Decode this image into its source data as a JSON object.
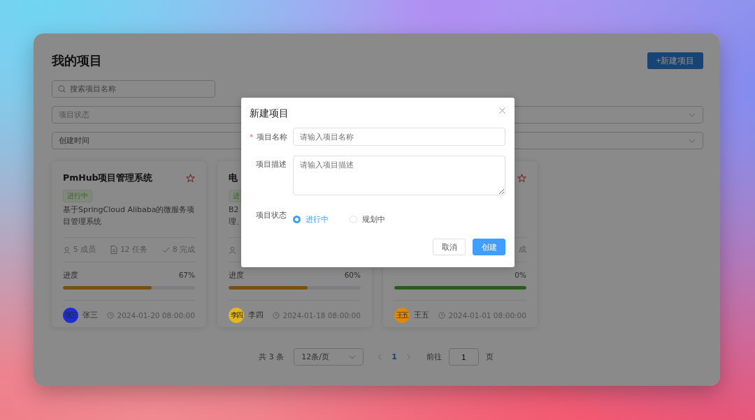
{
  "page": {
    "title": "我的项目",
    "new_button": "+新建项目",
    "search": {
      "placeholder": "搜索项目名称"
    },
    "filters": [
      {
        "placeholder": "项目状态"
      },
      {
        "value": "创建时间"
      }
    ]
  },
  "cards": [
    {
      "title": "PmHub项目管理系统",
      "tag": "进行中",
      "star": true,
      "description": [
        "基于SpringCloud Alibaba的微服务项",
        "目管理系统"
      ],
      "stats": [
        {
          "kind": "members",
          "text": "5 成员",
          "show_icon": true
        },
        {
          "kind": "tasks",
          "text": "12 任务",
          "show_icon": true
        },
        {
          "kind": "done",
          "text": "8 完成",
          "show_icon": true
        }
      ],
      "progress_label": "进度",
      "progress_value": "67%",
      "level": 0.67,
      "owner": {
        "avatar_text": "张三",
        "color": "#1b2ed4",
        "name": "张三"
      },
      "created": "2024-01-20 08:00:00"
    },
    {
      "title": "电",
      "tag": "进",
      "star": false,
      "description": [
        "B2",
        "理、"
      ],
      "stats": [
        {
          "kind": "members",
          "show_icon": true
        }
      ],
      "progress_label": "进度",
      "progress_value": "60%",
      "level": 0.6,
      "owner": {
        "avatar_text": "李四",
        "color": "#e2b81c",
        "name": "李四"
      },
      "created": "2024-01-18 08:00:00"
    },
    {
      "star": true,
      "stats": [
        {
          "kind": "done",
          "text": "成",
          "show_icon": false
        }
      ],
      "progress_value": "0%",
      "level": 1,
      "owner": {
        "avatar_text": "王五",
        "color": "#dd8a0c",
        "name": "王五"
      },
      "created": "2024-01-01 08:00:00"
    }
  ],
  "pagination": {
    "total": "共 3 条",
    "page_size": "12条/页",
    "pages": [
      {
        "label": "1",
        "selected": true
      }
    ],
    "jump_label": "前往",
    "jump_value": "1",
    "jump_suffix": "页"
  },
  "dialog": {
    "title": "新建项目",
    "fields": [
      {
        "kind": "input",
        "label": "项目名称",
        "required_mark": "*",
        "placeholder": "请输入项目名称"
      },
      {
        "kind": "textarea",
        "label": "项目描述",
        "placeholder": "请输入项目描述"
      },
      {
        "kind": "radio",
        "label": "项目状态",
        "options": [
          {
            "label": "进行中",
            "selected": true
          },
          {
            "label": "规划中",
            "selected": false
          }
        ]
      }
    ],
    "buttons": [
      {
        "kind": "default",
        "label": "取消"
      },
      {
        "kind": "primary",
        "label": "创建"
      }
    ]
  }
}
